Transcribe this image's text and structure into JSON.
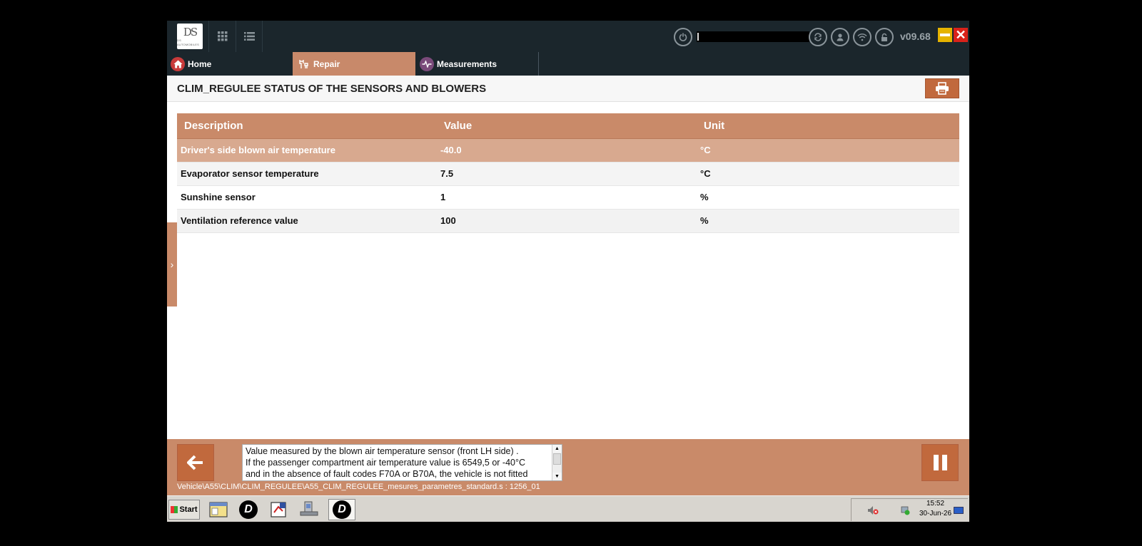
{
  "window": {
    "version": "v09.68",
    "user_field_value": ""
  },
  "tabs": {
    "home": "Home",
    "repair": "Repair",
    "measurements": "Measurements"
  },
  "page": {
    "title": "CLIM_REGULEE STATUS OF THE SENSORS AND BLOWERS"
  },
  "table": {
    "headers": [
      "Description",
      "Value",
      "Unit"
    ],
    "rows": [
      {
        "description": "Driver's side blown air temperature",
        "value": "-40.0",
        "unit": "°C"
      },
      {
        "description": "Evaporator sensor temperature",
        "value": "7.5",
        "unit": "°C"
      },
      {
        "description": "Sunshine sensor",
        "value": "1",
        "unit": "%"
      },
      {
        "description": "Ventilation reference value",
        "value": "100",
        "unit": "%"
      }
    ]
  },
  "info": {
    "text": "Value measured by the blown air temperature sensor (front LH side) .\nIf the passenger compartment air temperature value is 6549,5 or -40°C\nand in the absence of fault codes F70A or B70A, the vehicle is not fitted",
    "path": "Vehicle\\A55\\CLIM\\CLIM_REGULEE\\A55_CLIM_REGULEE_mesures_parametres_standard.s : 1256_01"
  },
  "taskbar": {
    "start_label": "Start",
    "time": "15:52",
    "date": "30-Jun-26"
  },
  "colors": {
    "accent": "#c98a69",
    "button": "#c1693d",
    "topbar": "#1b262c"
  }
}
